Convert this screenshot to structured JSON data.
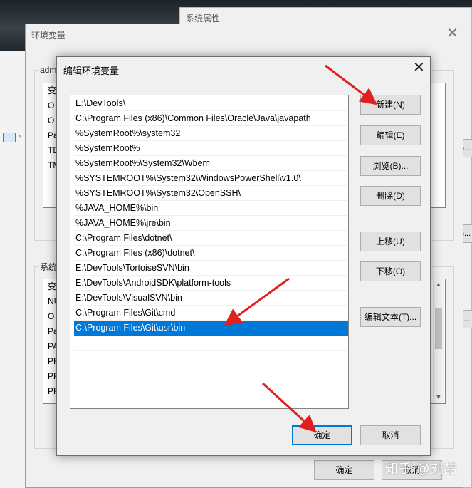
{
  "system_properties": {
    "title": "系统属性",
    "partial_buttons": [
      "S)...",
      "E)...",
      "T)..."
    ]
  },
  "env_window": {
    "title": "环境变量",
    "user_group_label": "adm",
    "user_list": [
      "变",
      "O",
      "O",
      "Pa",
      "TE",
      "TM"
    ],
    "system_group_label": "系统",
    "system_list": [
      "变",
      "NU",
      "O",
      "Pa",
      "PA",
      "PR",
      "PR",
      "PR"
    ],
    "ok_label": "确定",
    "cancel_label": "取消"
  },
  "edit_dialog": {
    "title": "编辑环境变量",
    "paths": [
      "E:\\DevTools\\",
      "C:\\Program Files (x86)\\Common Files\\Oracle\\Java\\javapath",
      "%SystemRoot%\\system32",
      "%SystemRoot%",
      "%SystemRoot%\\System32\\Wbem",
      "%SYSTEMROOT%\\System32\\WindowsPowerShell\\v1.0\\",
      "%SYSTEMROOT%\\System32\\OpenSSH\\",
      "%JAVA_HOME%\\bin",
      "%JAVA_HOME%\\jre\\bin",
      "C:\\Program Files\\dotnet\\",
      "C:\\Program Files (x86)\\dotnet\\",
      "E:\\DevTools\\TortoiseSVN\\bin",
      "E:\\DevTools\\AndroidSDK\\platform-tools",
      "E:\\DevTools\\VisualSVN\\bin",
      "C:\\Program Files\\Git\\cmd",
      "C:\\Program Files\\Git\\usr\\bin"
    ],
    "selected_index": 15,
    "buttons": {
      "new": "新建(N)",
      "edit": "编辑(E)",
      "browse": "浏览(B)...",
      "delete": "删除(D)",
      "move_up": "上移(U)",
      "move_down": "下移(O)",
      "edit_text": "编辑文本(T)..."
    },
    "ok_label": "确定",
    "cancel_label": "取消"
  },
  "watermark": "知乎 @刘喆",
  "annotation_color": "#e02020"
}
